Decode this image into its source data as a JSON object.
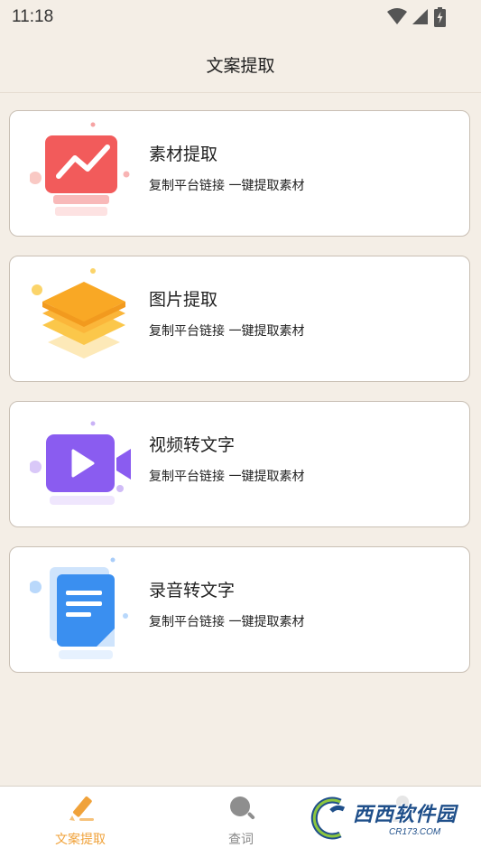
{
  "status_bar": {
    "time": "11:18",
    "icons": [
      "wifi-icon",
      "signal-icon",
      "battery-charging-icon"
    ]
  },
  "header": {
    "title": "文案提取"
  },
  "cards": [
    {
      "title": "素材提取",
      "subtitle": "复制平台链接 一键提取素材",
      "icon": "chart-monitor-icon",
      "color": "#f25b5b"
    },
    {
      "title": "图片提取",
      "subtitle": "复制平台链接 一键提取素材",
      "icon": "layers-icon",
      "color": "#f9b52a"
    },
    {
      "title": "视频转文字",
      "subtitle": "复制平台链接 一键提取素材",
      "icon": "video-camera-icon",
      "color": "#8a5cf0"
    },
    {
      "title": "录音转文字",
      "subtitle": "复制平台链接 一键提取素材",
      "icon": "document-icon",
      "color": "#3a8ff0"
    }
  ],
  "tabs": [
    {
      "label": "文案提取",
      "icon": "pencil-icon",
      "active": true
    },
    {
      "label": "查词",
      "icon": "search-icon",
      "active": false
    },
    {
      "label": "",
      "icon": "user-icon",
      "active": false
    }
  ],
  "watermark": {
    "text": "西西软件园",
    "sub": "CR173.COM"
  },
  "colors": {
    "accent": "#f0a23a",
    "background": "#f4eee6"
  }
}
